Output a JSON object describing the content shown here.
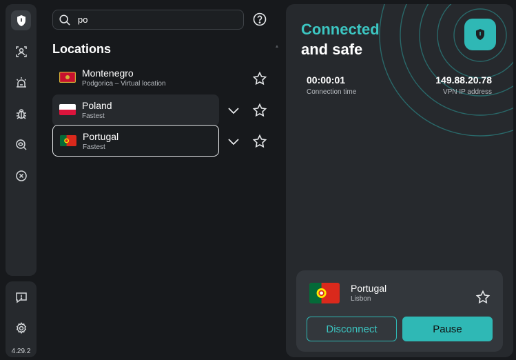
{
  "sidebar": {
    "icons": [
      "shield-icon",
      "person-scan-icon",
      "alarm-icon",
      "bug-icon",
      "search-eye-icon",
      "block-icon"
    ],
    "bottom_icons": [
      "feedback-icon",
      "settings-icon"
    ],
    "version": "4.29.2"
  },
  "search": {
    "value": "po",
    "placeholder": ""
  },
  "locations": {
    "title": "Locations",
    "items": [
      {
        "name": "Montenegro",
        "sub": "Podgorica – Virtual location",
        "flag": "montenegro"
      },
      {
        "name": "Poland",
        "sub": "Fastest",
        "flag": "poland"
      },
      {
        "name": "Portugal",
        "sub": "Fastest",
        "flag": "portugal"
      }
    ]
  },
  "status": {
    "line1": "Connected",
    "line2": "and safe",
    "time": "00:00:01",
    "time_label": "Connection time",
    "ip": "149.88.20.78",
    "ip_label": "VPN IP address"
  },
  "current": {
    "country": "Portugal",
    "city": "Lisbon",
    "disconnect_label": "Disconnect",
    "pause_label": "Pause"
  },
  "colors": {
    "accent": "#2fb8b5",
    "accent_text": "#3cc6c2",
    "background": "#17191c",
    "panel": "#26292d"
  }
}
